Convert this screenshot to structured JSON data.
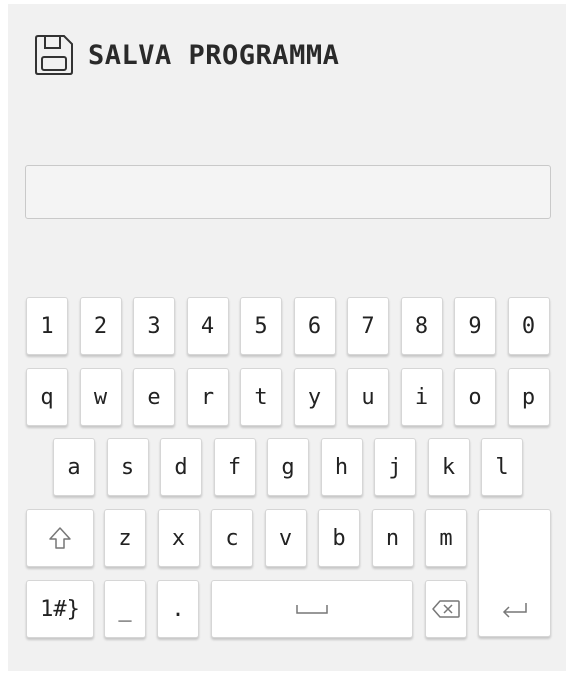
{
  "header": {
    "title": "SALVA PROGRAMMA",
    "icon": "floppy-disk-icon"
  },
  "name_input": {
    "value": "",
    "placeholder": ""
  },
  "keyboard": {
    "row_numbers": [
      "1",
      "2",
      "3",
      "4",
      "5",
      "6",
      "7",
      "8",
      "9",
      "0"
    ],
    "row_top": [
      "q",
      "w",
      "e",
      "r",
      "t",
      "y",
      "u",
      "i",
      "o",
      "p"
    ],
    "row_middle": [
      "a",
      "s",
      "d",
      "f",
      "g",
      "h",
      "j",
      "k",
      "l"
    ],
    "row_bottom": [
      "z",
      "x",
      "c",
      "v",
      "b",
      "n",
      "m"
    ],
    "shift_icon": "shift-arrow-icon",
    "symbols_label": "1#}",
    "underscore_label": "_",
    "dot_label": ".",
    "space_icon": "space-bar-icon",
    "backspace_icon": "backspace-icon",
    "enter_icon": "enter-return-icon"
  },
  "colors": {
    "background": "#f1f1f1",
    "key_background": "#ffffff",
    "text": "#2a2a2a"
  }
}
